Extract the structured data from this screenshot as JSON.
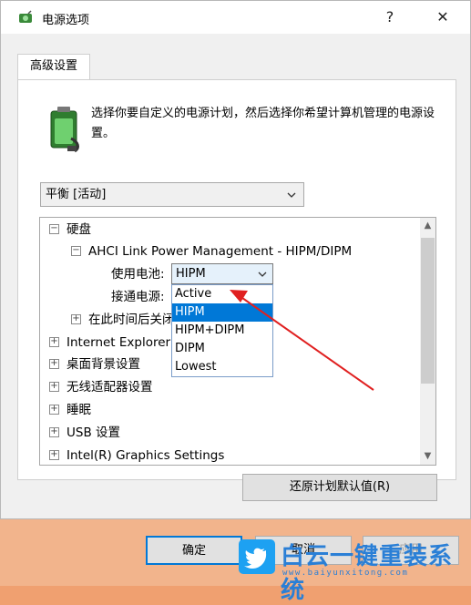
{
  "window": {
    "title": "电源选项",
    "help_glyph": "?",
    "close_glyph": "✕"
  },
  "tabs": [
    {
      "label": "高级设置"
    }
  ],
  "description": "选择你要自定义的电源计划，然后选择你希望计算机管理的电源设置。",
  "plan_select": {
    "value": "平衡 [活动]"
  },
  "tree": {
    "items": [
      {
        "label": "硬盘",
        "expander": "⊟"
      },
      {
        "label": "AHCI Link Power Management - HIPM/DIPM",
        "expander": "⊟"
      },
      {
        "label": "使用电池:"
      },
      {
        "label": "接通电源:"
      },
      {
        "label": "在此时间后关闭硬盘",
        "expander": "⊞"
      },
      {
        "label": "Internet Explorer",
        "expander": "⊞"
      },
      {
        "label": "桌面背景设置",
        "expander": "⊞"
      },
      {
        "label": "无线适配器设置",
        "expander": "⊞"
      },
      {
        "label": "睡眠",
        "expander": "⊞"
      },
      {
        "label": "USB 设置",
        "expander": "⊞"
      },
      {
        "label": "Intel(R) Graphics Settings",
        "expander": "⊞"
      }
    ],
    "battery_value": "HIPM",
    "dropdown_options": [
      "Active",
      "HIPM",
      "HIPM+DIPM",
      "DIPM",
      "Lowest"
    ],
    "dropdown_selected": "HIPM"
  },
  "buttons": {
    "restore": "还原计划默认值(R)",
    "ok": "确定",
    "cancel": "取消",
    "apply": "应用"
  },
  "watermark": {
    "text": "白云一键重装系统",
    "url": "www.baiyunxitong.com"
  },
  "colors": {
    "accent": "#0078d7",
    "annotation_arrow": "#e02020",
    "background_outer": "#f0a070"
  }
}
